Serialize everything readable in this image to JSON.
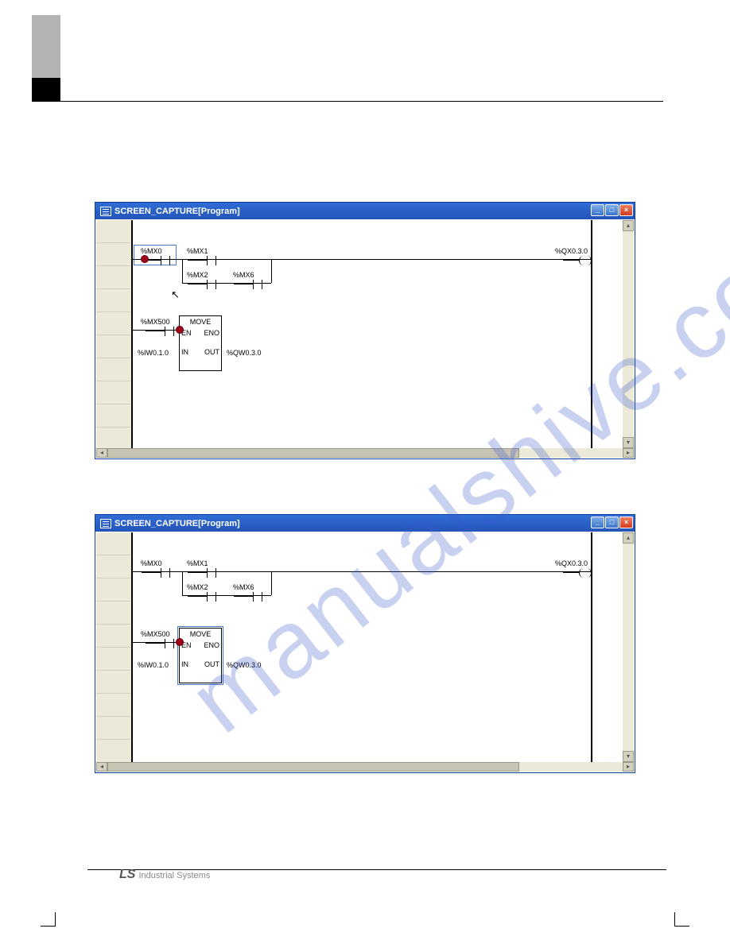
{
  "windowA": {
    "title": "SCREEN_CAPTURE[Program]",
    "rung1": {
      "c0": "%MX0",
      "c1": "%MX1",
      "c2": "%MX2",
      "c3": "%MX6",
      "out": "%QX0.3.0"
    },
    "rung2": {
      "c0": "%MX500",
      "fb": {
        "name": "MOVE",
        "en": "EN",
        "eno": "ENO",
        "in": "IN",
        "out": "OUT"
      },
      "inval": "%IW0.1.0",
      "outval": "%QW0.3.0"
    }
  },
  "windowB": {
    "title": "SCREEN_CAPTURE[Program]",
    "rung1": {
      "c0": "%MX0",
      "c1": "%MX1",
      "c2": "%MX2",
      "c3": "%MX6",
      "out": "%QX0.3.0"
    },
    "rung2": {
      "c0": "%MX500",
      "fb": {
        "name": "MOVE",
        "en": "EN",
        "eno": "ENO",
        "in": "IN",
        "out": "OUT"
      },
      "inval": "%IW0.1.0",
      "outval": "%QW0.3.0"
    }
  },
  "watermark": "manualshive.com",
  "footer": {
    "page": "",
    "logo": "LS",
    "brand": "Industrial Systems"
  }
}
